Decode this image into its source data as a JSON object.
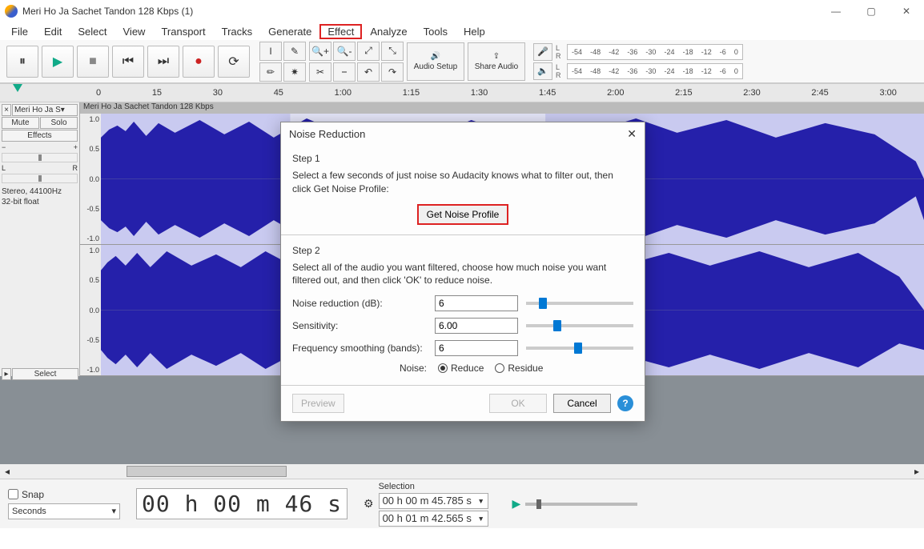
{
  "window": {
    "title": "Meri Ho Ja Sachet Tandon 128 Kbps (1)"
  },
  "menu": [
    "File",
    "Edit",
    "Select",
    "View",
    "Transport",
    "Tracks",
    "Generate",
    "Effect",
    "Analyze",
    "Tools",
    "Help"
  ],
  "ruler_ticks": [
    "0",
    "15",
    "30",
    "45",
    "1:00",
    "1:15",
    "1:30",
    "1:45",
    "2:00",
    "2:15",
    "2:30",
    "2:45",
    "3:00"
  ],
  "toolbar": {
    "audio_setup": "Audio Setup",
    "share_audio": "Share Audio"
  },
  "meter": {
    "scale": [
      "-54",
      "-48",
      "-42",
      "-36",
      "-30",
      "-24",
      "-18",
      "-12",
      "-6",
      "0"
    ]
  },
  "track": {
    "dropdown_name": "Meri Ho Ja S",
    "mute": "Mute",
    "solo": "Solo",
    "effects": "Effects",
    "info1": "Stereo, 44100Hz",
    "info2": "32-bit float",
    "title": "Meri Ho Ja Sachet Tandon 128 Kbps",
    "amp_labels": [
      "1.0",
      "0.5",
      "0.0",
      "-0.5",
      "-1.0"
    ],
    "select": "Select"
  },
  "dialog": {
    "title": "Noise Reduction",
    "step1_title": "Step 1",
    "step1_desc": "Select a few seconds of just noise so Audacity knows what to filter out, then click Get Noise Profile:",
    "get_profile": "Get Noise Profile",
    "step2_title": "Step 2",
    "step2_desc": "Select all of the audio you want filtered, choose how much noise you want filtered out, and then click 'OK' to reduce noise.",
    "noise_reduction_label": "Noise reduction (dB):",
    "noise_reduction_value": "6",
    "sensitivity_label": "Sensitivity:",
    "sensitivity_value": "6.00",
    "freq_smoothing_label": "Frequency smoothing (bands):",
    "freq_smoothing_value": "6",
    "noise_label": "Noise:",
    "reduce": "Reduce",
    "residue": "Residue",
    "preview": "Preview",
    "ok": "OK",
    "cancel": "Cancel"
  },
  "bottombar": {
    "snap": "Snap",
    "snap_unit": "Seconds",
    "main_time": "00 h 00 m 46 s",
    "selection_label": "Selection",
    "sel_start": "00 h 00 m 45.785 s",
    "sel_end": "00 h 01 m 42.565 s"
  }
}
